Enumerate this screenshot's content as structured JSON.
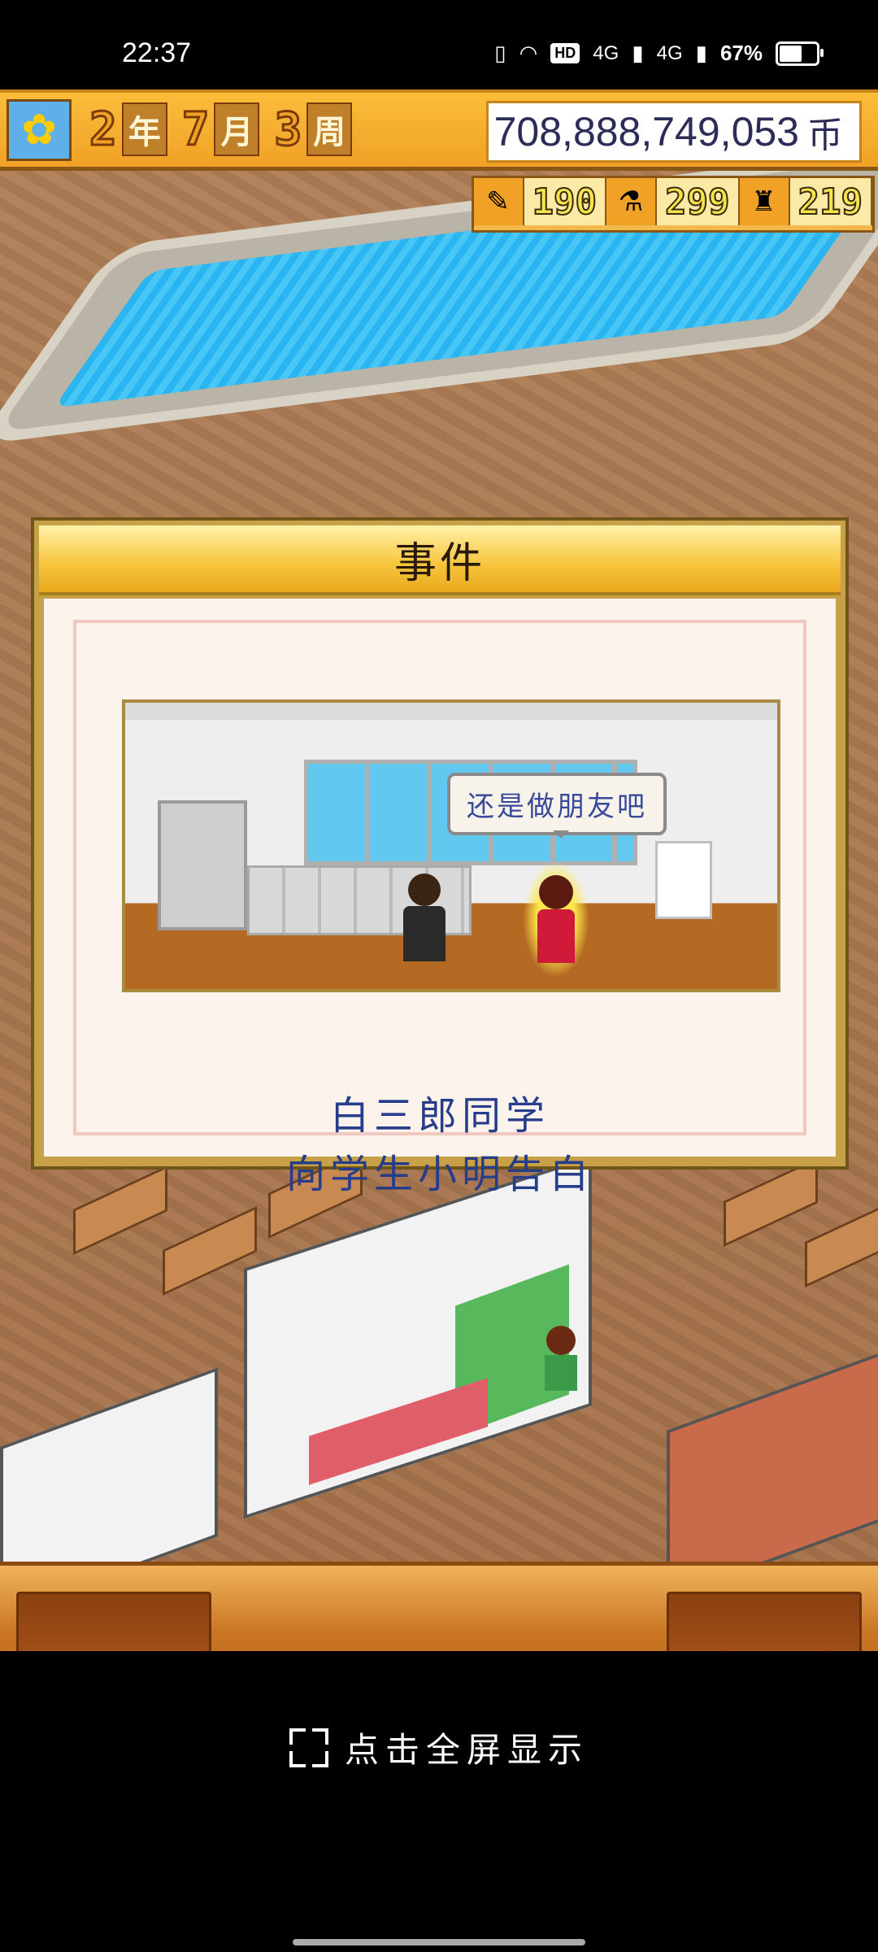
{
  "status_bar": {
    "time": "22:37",
    "network_badge": "HD",
    "signal_1": "4G",
    "signal_2": "4G",
    "battery_percent": "67%",
    "battery_level": 0.67
  },
  "hud": {
    "season_icon": "sunflower-icon",
    "year": "2",
    "year_unit": "年",
    "month": "7",
    "month_unit": "月",
    "week": "3",
    "week_unit": "周",
    "money": "708,888,749,053",
    "money_unit": "币"
  },
  "resources": [
    {
      "icon": "pencil-icon",
      "value": "190"
    },
    {
      "icon": "flask-icon",
      "value": "299"
    },
    {
      "icon": "trophy-icon",
      "value": "219"
    }
  ],
  "event_dialog": {
    "title": "事件",
    "speech_bubble": "还是做朋友吧",
    "line_1": "白三郎同学",
    "line_2": "向学生小明告白"
  },
  "fullscreen_prompt": {
    "label": "点击全屏显示",
    "icon": "expand-icon"
  },
  "colors": {
    "hud_orange": "#f0a126",
    "modal_title_bar": "#f7c43b",
    "event_text": "#263d8c",
    "panel_brown": "#b86418"
  }
}
